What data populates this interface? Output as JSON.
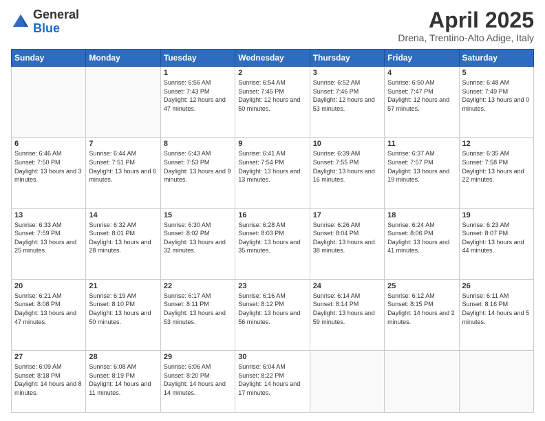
{
  "header": {
    "logo_general": "General",
    "logo_blue": "Blue",
    "month_title": "April 2025",
    "location": "Drena, Trentino-Alto Adige, Italy"
  },
  "days_of_week": [
    "Sunday",
    "Monday",
    "Tuesday",
    "Wednesday",
    "Thursday",
    "Friday",
    "Saturday"
  ],
  "weeks": [
    [
      {
        "day": "",
        "info": ""
      },
      {
        "day": "",
        "info": ""
      },
      {
        "day": "1",
        "info": "Sunrise: 6:56 AM\nSunset: 7:43 PM\nDaylight: 12 hours and 47 minutes."
      },
      {
        "day": "2",
        "info": "Sunrise: 6:54 AM\nSunset: 7:45 PM\nDaylight: 12 hours and 50 minutes."
      },
      {
        "day": "3",
        "info": "Sunrise: 6:52 AM\nSunset: 7:46 PM\nDaylight: 12 hours and 53 minutes."
      },
      {
        "day": "4",
        "info": "Sunrise: 6:50 AM\nSunset: 7:47 PM\nDaylight: 12 hours and 57 minutes."
      },
      {
        "day": "5",
        "info": "Sunrise: 6:48 AM\nSunset: 7:49 PM\nDaylight: 13 hours and 0 minutes."
      }
    ],
    [
      {
        "day": "6",
        "info": "Sunrise: 6:46 AM\nSunset: 7:50 PM\nDaylight: 13 hours and 3 minutes."
      },
      {
        "day": "7",
        "info": "Sunrise: 6:44 AM\nSunset: 7:51 PM\nDaylight: 13 hours and 6 minutes."
      },
      {
        "day": "8",
        "info": "Sunrise: 6:43 AM\nSunset: 7:53 PM\nDaylight: 13 hours and 9 minutes."
      },
      {
        "day": "9",
        "info": "Sunrise: 6:41 AM\nSunset: 7:54 PM\nDaylight: 13 hours and 13 minutes."
      },
      {
        "day": "10",
        "info": "Sunrise: 6:39 AM\nSunset: 7:55 PM\nDaylight: 13 hours and 16 minutes."
      },
      {
        "day": "11",
        "info": "Sunrise: 6:37 AM\nSunset: 7:57 PM\nDaylight: 13 hours and 19 minutes."
      },
      {
        "day": "12",
        "info": "Sunrise: 6:35 AM\nSunset: 7:58 PM\nDaylight: 13 hours and 22 minutes."
      }
    ],
    [
      {
        "day": "13",
        "info": "Sunrise: 6:33 AM\nSunset: 7:59 PM\nDaylight: 13 hours and 25 minutes."
      },
      {
        "day": "14",
        "info": "Sunrise: 6:32 AM\nSunset: 8:01 PM\nDaylight: 13 hours and 28 minutes."
      },
      {
        "day": "15",
        "info": "Sunrise: 6:30 AM\nSunset: 8:02 PM\nDaylight: 13 hours and 32 minutes."
      },
      {
        "day": "16",
        "info": "Sunrise: 6:28 AM\nSunset: 8:03 PM\nDaylight: 13 hours and 35 minutes."
      },
      {
        "day": "17",
        "info": "Sunrise: 6:26 AM\nSunset: 8:04 PM\nDaylight: 13 hours and 38 minutes."
      },
      {
        "day": "18",
        "info": "Sunrise: 6:24 AM\nSunset: 8:06 PM\nDaylight: 13 hours and 41 minutes."
      },
      {
        "day": "19",
        "info": "Sunrise: 6:23 AM\nSunset: 8:07 PM\nDaylight: 13 hours and 44 minutes."
      }
    ],
    [
      {
        "day": "20",
        "info": "Sunrise: 6:21 AM\nSunset: 8:08 PM\nDaylight: 13 hours and 47 minutes."
      },
      {
        "day": "21",
        "info": "Sunrise: 6:19 AM\nSunset: 8:10 PM\nDaylight: 13 hours and 50 minutes."
      },
      {
        "day": "22",
        "info": "Sunrise: 6:17 AM\nSunset: 8:11 PM\nDaylight: 13 hours and 53 minutes."
      },
      {
        "day": "23",
        "info": "Sunrise: 6:16 AM\nSunset: 8:12 PM\nDaylight: 13 hours and 56 minutes."
      },
      {
        "day": "24",
        "info": "Sunrise: 6:14 AM\nSunset: 8:14 PM\nDaylight: 13 hours and 59 minutes."
      },
      {
        "day": "25",
        "info": "Sunrise: 6:12 AM\nSunset: 8:15 PM\nDaylight: 14 hours and 2 minutes."
      },
      {
        "day": "26",
        "info": "Sunrise: 6:11 AM\nSunset: 8:16 PM\nDaylight: 14 hours and 5 minutes."
      }
    ],
    [
      {
        "day": "27",
        "info": "Sunrise: 6:09 AM\nSunset: 8:18 PM\nDaylight: 14 hours and 8 minutes."
      },
      {
        "day": "28",
        "info": "Sunrise: 6:08 AM\nSunset: 8:19 PM\nDaylight: 14 hours and 11 minutes."
      },
      {
        "day": "29",
        "info": "Sunrise: 6:06 AM\nSunset: 8:20 PM\nDaylight: 14 hours and 14 minutes."
      },
      {
        "day": "30",
        "info": "Sunrise: 6:04 AM\nSunset: 8:22 PM\nDaylight: 14 hours and 17 minutes."
      },
      {
        "day": "",
        "info": ""
      },
      {
        "day": "",
        "info": ""
      },
      {
        "day": "",
        "info": ""
      }
    ]
  ]
}
